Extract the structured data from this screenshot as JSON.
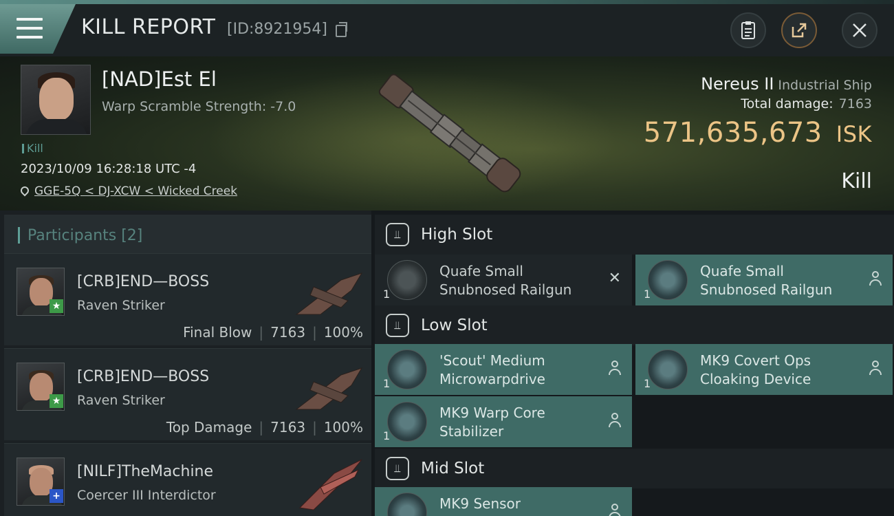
{
  "header": {
    "title": "KILL REPORT",
    "report_id": "[ID:8921954]",
    "menu_icon": "hamburger-icon",
    "buttons": [
      "clipboard-icon",
      "share-icon",
      "close-icon"
    ]
  },
  "victim": {
    "name": "[NAD]Est El",
    "subtitle": "Warp Scramble Strength: -7.0",
    "tag": "Kill",
    "datetime": "2023/10/09 16:28:18 UTC -4",
    "location": "GGE-5Q < DJ-XCW < Wicked Creek",
    "ship_name": "Nereus II",
    "ship_class": "Industrial Ship",
    "total_damage_label": "Total damage:",
    "total_damage_value": "7163",
    "isk_value": "571,635,673",
    "isk_unit": "ISK",
    "result": "Kill"
  },
  "participants": {
    "heading": "Participants [2]",
    "rows": [
      {
        "name": "[CRB]END—BOSS",
        "ship": "Raven Striker",
        "role": "Final Blow",
        "damage": "7163",
        "percent": "100%",
        "badge": "★",
        "badge_color": "green"
      },
      {
        "name": "[CRB]END—BOSS",
        "ship": "Raven Striker",
        "role": "Top Damage",
        "damage": "7163",
        "percent": "100%",
        "badge": "★",
        "badge_color": "green"
      },
      {
        "name": "[NILF]TheMachine",
        "ship": "Coercer III Interdictor",
        "badge": "+",
        "badge_color": "blue"
      }
    ]
  },
  "fitting": {
    "high": {
      "title": "High Slot",
      "items": [
        {
          "qty": "1",
          "name_l1": "Quafe Small",
          "name_l2": "Snubnosed Railgun",
          "status": "destroyed"
        },
        {
          "qty": "1",
          "name_l1": "Quafe Small",
          "name_l2": "Snubnosed Railgun",
          "status": "dropped"
        }
      ]
    },
    "low": {
      "title": "Low Slot",
      "items": [
        {
          "qty": "1",
          "name_l1": "'Scout' Medium",
          "name_l2": "Microwarpdrive",
          "status": "dropped"
        },
        {
          "qty": "1",
          "name_l1": "MK9 Covert Ops",
          "name_l2": "Cloaking Device",
          "status": "dropped"
        },
        {
          "qty": "1",
          "name_l1": "MK9 Warp Core",
          "name_l2": "Stabilizer",
          "status": "dropped"
        }
      ]
    },
    "mid": {
      "title": "Mid Slot",
      "items": [
        {
          "qty": "",
          "name_l1": "MK9 Sensor",
          "name_l2": "",
          "status": "dropped"
        }
      ]
    }
  },
  "colors": {
    "accent_teal": "#3f6b66",
    "isk_gold": "#ecc486",
    "badge_green": "#3d9a48",
    "badge_blue": "#2b56c7"
  }
}
